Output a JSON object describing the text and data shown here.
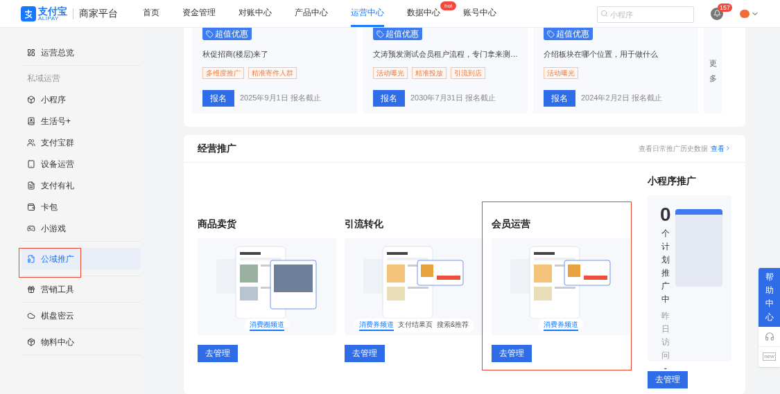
{
  "header": {
    "logo": {
      "name": "支付宝",
      "sub": "ALIPAY"
    },
    "platform": "商家平台",
    "nav": [
      {
        "label": "首页",
        "selected": false
      },
      {
        "label": "资金管理",
        "selected": false
      },
      {
        "label": "对账中心",
        "selected": false
      },
      {
        "label": "产品中心",
        "selected": false
      },
      {
        "label": "运营中心",
        "selected": true
      },
      {
        "label": "数据中心",
        "selected": false,
        "badge": "hot"
      },
      {
        "label": "账号中心",
        "selected": false
      }
    ],
    "search": {
      "placeholder": "小程序"
    },
    "notifications": "157"
  },
  "sidebar": {
    "groups": [
      {
        "items": [
          {
            "label": "运营总览",
            "selected": false,
            "highlighted": false
          }
        ]
      },
      {
        "title": "私域运营",
        "items": [
          {
            "label": "小程序",
            "selected": false,
            "highlighted": false
          },
          {
            "label": "生活号+",
            "selected": false,
            "highlighted": false
          },
          {
            "label": "支付宝群",
            "selected": false,
            "highlighted": false
          },
          {
            "label": "设备运营",
            "selected": false,
            "highlighted": false
          },
          {
            "label": "支付有礼",
            "selected": false,
            "highlighted": false
          },
          {
            "label": "卡包",
            "selected": false,
            "highlighted": false
          },
          {
            "label": "小游戏",
            "selected": false,
            "highlighted": false
          }
        ]
      },
      {
        "items": [
          {
            "label": "公域推广",
            "selected": true,
            "highlighted": true
          }
        ]
      },
      {
        "items": [
          {
            "label": "营销工具",
            "selected": false,
            "highlighted": false
          }
        ]
      },
      {
        "items": [
          {
            "label": "棋盘密云",
            "selected": false,
            "highlighted": false
          }
        ]
      },
      {
        "items": [
          {
            "label": "物料中心",
            "selected": false,
            "highlighted": false
          }
        ]
      }
    ]
  },
  "campaigns": {
    "cards": [
      {
        "badge": "超值优惠",
        "title": "秋促招商(楼层)来了",
        "tags": [
          "多维度推广",
          "精准寄件人群"
        ],
        "button": "报名",
        "deadline": "2025年9月1日 报名截止"
      },
      {
        "badge": "超值优惠",
        "title": "文涛预发测试会员租户流程，专门拿来测…",
        "tags": [
          "活动曝光",
          "精准投放",
          "引流到店"
        ],
        "button": "报名",
        "deadline": "2030年7月31日 报名截止"
      },
      {
        "badge": "超值优惠",
        "title": "介绍板块在哪个位置，用于做什么",
        "tags": [
          "活动曝光"
        ],
        "button": "报名",
        "deadline": "2024年2月2日 报名截止"
      }
    ],
    "more": "更多"
  },
  "promotion": {
    "title": "经营推广",
    "history_text": "查看日常推广历史数据",
    "history_link": "查看",
    "columns": [
      {
        "title": "商品卖货",
        "highlighted": false,
        "tabs": [
          {
            "label": "消费圈频道",
            "selected": true
          }
        ],
        "button": "去管理"
      },
      {
        "title": "引流转化",
        "highlighted": false,
        "tabs": [
          {
            "label": "消费券频道",
            "selected": true
          },
          {
            "label": "支付结果页",
            "selected": false
          },
          {
            "label": "搜索&推荐",
            "selected": false
          }
        ],
        "button": "去管理"
      },
      {
        "title": "会员运营",
        "highlighted": true,
        "tabs": [
          {
            "label": "消费券频道",
            "selected": true
          }
        ],
        "button": "去管理"
      }
    ],
    "mini_program": {
      "title": "小程序推广",
      "count": "0",
      "count_label": "个计划推广中",
      "visits_label": "昨日访问",
      "visits": "-",
      "button": "去管理"
    }
  },
  "help_widget": {
    "label": "帮助中心",
    "new_label": "new"
  }
}
